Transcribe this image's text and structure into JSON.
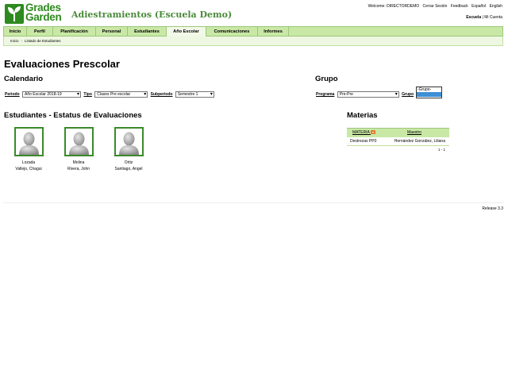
{
  "header": {
    "logo_line1": "Grades",
    "logo_line2": "Garden",
    "school_title": "Adiestramientos (Escuela Demo)",
    "welcome": "Welcome: DIRECTORDEMO",
    "links": [
      "Cerrar Sesión",
      "Feedback",
      "Español",
      "English"
    ],
    "school_link": "Escuela",
    "school_sep": " |",
    "mi_cuenta": "Mi Cuenta"
  },
  "nav": {
    "tabs": [
      "Inicio",
      "Perfil",
      "Planificación",
      "Personal",
      "Estudiantes",
      "Año Escolar",
      "Comunicaciones",
      "Informes"
    ],
    "active_index": 5
  },
  "breadcrumb": {
    "items": [
      "Inicio",
      "Listado de Estudiantes"
    ],
    "separator": "›"
  },
  "main": {
    "page_title": "Evaluaciones Prescolar",
    "calendario": {
      "title": "Calendario",
      "periodo_label": "Periodo",
      "periodo_value": "Año Escolar 2018-19",
      "tipo_label": "Tipo",
      "tipo_value": "Clases Pre escolar",
      "subperiodo_label": "Subperiodo",
      "subperiodo_value": "Semestre 1"
    },
    "grupo": {
      "title": "Grupo",
      "programa_label": "Programa",
      "programa_value": "Pre-Pre",
      "grupo_label": "Grupo",
      "grupo_option": "-Grupo-"
    },
    "students_title": "Estudiantes - Estatus de Evaluaciones",
    "students": [
      {
        "line1": "Lozada",
        "line2": "Vallejo, Chagui"
      },
      {
        "line1": "Molina",
        "line2": "Rivera, John"
      },
      {
        "line1": "Ortiz",
        "line2": "Santiago, Angel"
      }
    ],
    "materias": {
      "title": "Materias",
      "col_materia": "MATERIA",
      "col_maestro": "Maestro",
      "rows": [
        {
          "materia": "Destrezas PP0",
          "maestro": "Hernández González, Liliana"
        }
      ],
      "pager": "1 - 1"
    }
  },
  "footer": {
    "release": "Release 3.3"
  },
  "colors": {
    "brand_green": "#2d8a1e",
    "nav_bg": "#c9e8a5",
    "avatar_border": "#3a8a2a",
    "selected_blue": "#3d8fd6"
  }
}
